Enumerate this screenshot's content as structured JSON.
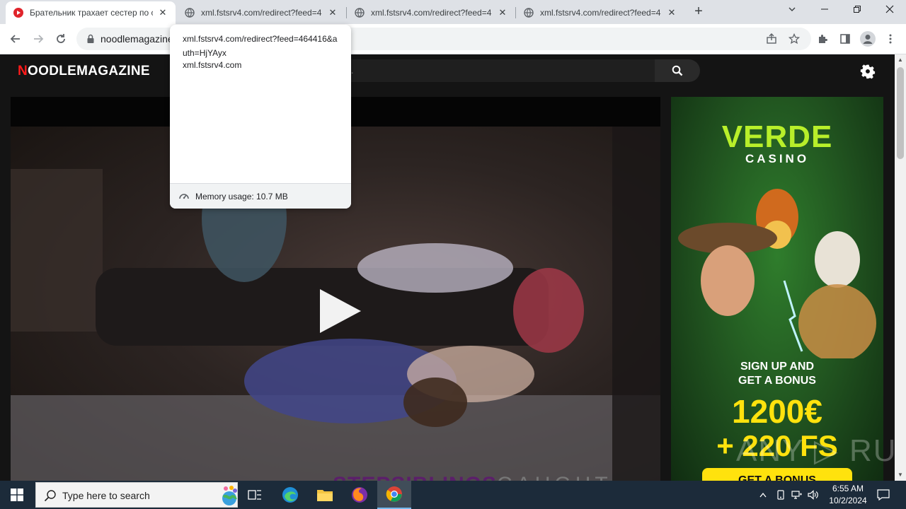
{
  "browser": {
    "tabs": [
      {
        "title": "Брательник трахает сестер по с",
        "active": true,
        "favicon": "red-play-icon"
      },
      {
        "title": "xml.fstsrv4.com/redirect?feed=4",
        "active": false,
        "favicon": "globe-icon"
      },
      {
        "title": "xml.fstsrv4.com/redirect?feed=4",
        "active": false,
        "favicon": "globe-icon"
      },
      {
        "title": "xml.fstsrv4.com/redirect?feed=4",
        "active": false,
        "favicon": "globe-icon"
      }
    ],
    "new_tab_label": "+",
    "address": "noodlemagazine",
    "hover_card": {
      "title": "xml.fstsrv4.com/redirect?feed=464416&auth=HjYAyx",
      "domain": "xml.fstsrv4.com",
      "memory": "Memory usage: 10.7 MB"
    }
  },
  "site": {
    "logo_first": "N",
    "logo_rest": "OODLEMAGAZINE",
    "search_placeholder": "n...",
    "video_watermark_bold": "STEPSIBLINGS",
    "video_watermark_thin": "CAUGHT"
  },
  "ad": {
    "brand": "VERDE",
    "brand_sub": "CASINO",
    "signup_line1": "SIGN UP AND",
    "signup_line2": "GET A BONUS",
    "amount": "1200€",
    "free_spins": "+ 220 FS",
    "cta": "GET A BONUS"
  },
  "overlay_watermark": "ANY ▷ RUN",
  "taskbar": {
    "search_placeholder": "Type here to search",
    "time": "6:55 AM",
    "date": "10/2/2024"
  },
  "colors": {
    "logo_accent": "#ff1a1a",
    "ad_brand": "#b8ef2a",
    "ad_amount": "#ffe20d",
    "taskbar_bg": "#1c2b3a"
  }
}
